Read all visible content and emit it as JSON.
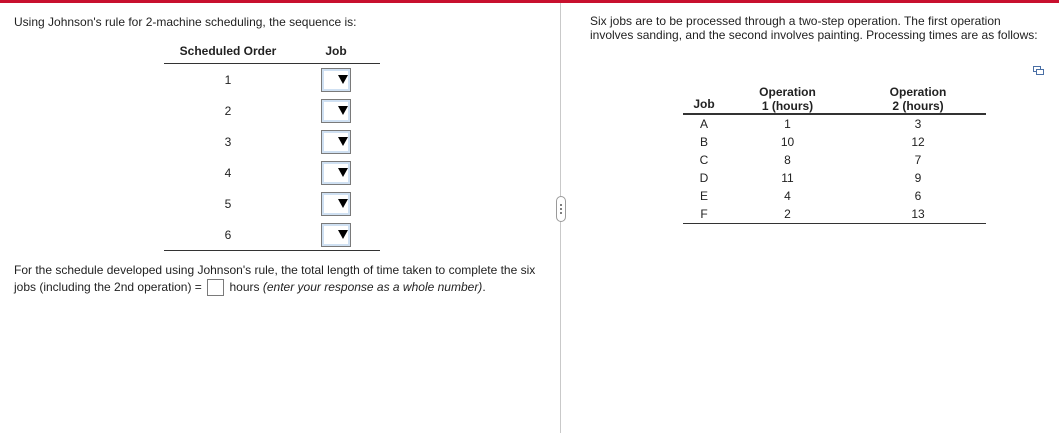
{
  "colors": {
    "accent_bar": "#c8102e",
    "border": "#333333"
  },
  "left": {
    "intro": "Using Johnson's rule for 2-machine scheduling, the sequence is:",
    "table": {
      "headers": [
        "Scheduled Order",
        "Job"
      ],
      "orders": [
        "1",
        "2",
        "3",
        "4",
        "5",
        "6"
      ],
      "dropdown_values": [
        "",
        "",
        "",
        "",
        "",
        ""
      ]
    },
    "question": {
      "part1": "For the schedule developed using Johnson's rule, the total length of time taken to complete the six jobs (including the 2nd operation) =",
      "units": "hours",
      "hint": "(enter your response as a whole number)",
      "period": ".",
      "answer_value": ""
    }
  },
  "right": {
    "problem": "Six jobs are to be processed through a two-step operation.  The first operation involves sanding, and the second involves painting. Processing times are as follows:",
    "copy_icon": "copy-icon",
    "table": {
      "headers": {
        "job": "Job",
        "op1_line1": "Operation",
        "op1_line2": "1 (hours)",
        "op2_line1": "Operation",
        "op2_line2": "2 (hours)"
      },
      "rows": [
        {
          "job": "A",
          "op1": "1",
          "op2": "3"
        },
        {
          "job": "B",
          "op1": "10",
          "op2": "12"
        },
        {
          "job": "C",
          "op1": "8",
          "op2": "7"
        },
        {
          "job": "D",
          "op1": "11",
          "op2": "9"
        },
        {
          "job": "E",
          "op1": "4",
          "op2": "6"
        },
        {
          "job": "F",
          "op1": "2",
          "op2": "13"
        }
      ]
    }
  }
}
